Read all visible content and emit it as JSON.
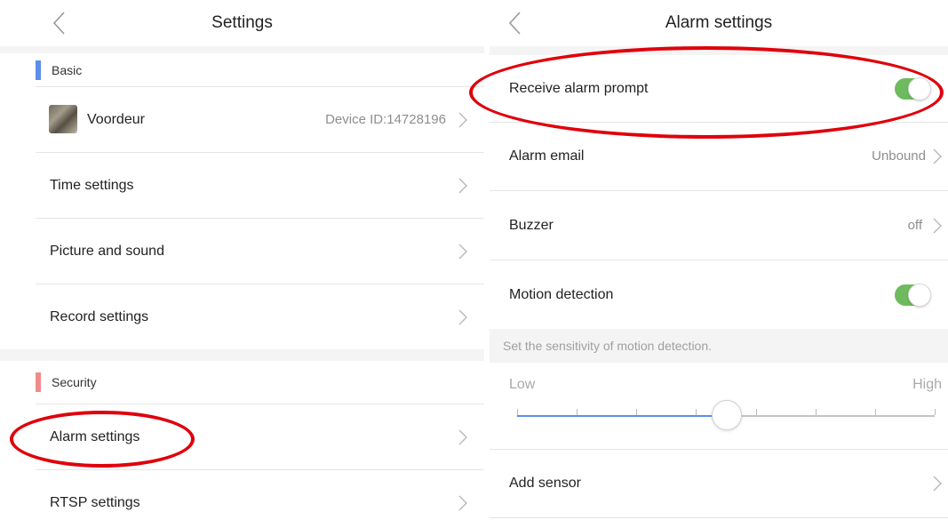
{
  "left": {
    "title": "Settings",
    "sections": [
      {
        "label": "Basic",
        "accent_color": "#5b8fe8",
        "device": {
          "name": "Voordeur",
          "id": "Device ID:14728196"
        },
        "items": [
          "Time settings",
          "Picture and sound",
          "Record settings"
        ]
      },
      {
        "label": "Security",
        "accent_color": "#f28a8a",
        "items": [
          "Alarm settings",
          "RTSP settings"
        ]
      }
    ]
  },
  "right": {
    "title": "Alarm settings",
    "rows": [
      {
        "label": "Receive alarm prompt",
        "type": "toggle",
        "on": true
      },
      {
        "label": "Alarm email",
        "type": "value",
        "value": "Unbound"
      },
      {
        "label": "Buzzer",
        "type": "value",
        "value": "off"
      },
      {
        "label": "Motion detection",
        "type": "toggle",
        "on": true
      }
    ],
    "sensitivity": {
      "note": "Set the sensitivity of motion detection.",
      "low": "Low",
      "high": "High",
      "level": 0.5,
      "steps": 7
    },
    "add_sensor": "Add sensor"
  },
  "colors": {
    "toggle_on": "#6dbb5e",
    "slider_active": "#5b8fe8",
    "highlight_circle": "#e0000b"
  },
  "icons": [
    "back-arrow-icon",
    "chevron-right-icon"
  ]
}
